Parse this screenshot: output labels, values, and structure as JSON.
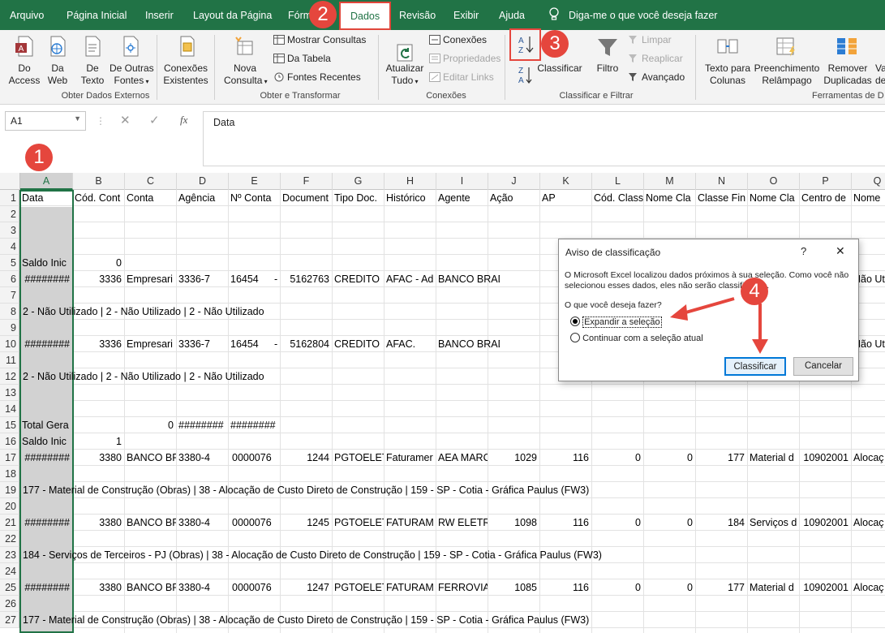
{
  "menu": {
    "tabs": [
      "Arquivo",
      "Página Inicial",
      "Inserir",
      "Layout da Página",
      "Fórm",
      "Dados",
      "Revisão",
      "Exibir",
      "Ajuda"
    ],
    "tell_me": "Diga-me o que você deseja fazer"
  },
  "ribbon": {
    "access": [
      "Do",
      "Access"
    ],
    "web": [
      "Da",
      "Web"
    ],
    "text": [
      "De",
      "Texto"
    ],
    "other": [
      "De Outras",
      "Fontes"
    ],
    "existing": [
      "Conexões",
      "Existentes"
    ],
    "group_external": "Obter Dados Externos",
    "new_query": [
      "Nova",
      "Consulta"
    ],
    "show_queries": "Mostrar Consultas",
    "from_table": "Da Tabela",
    "recent_sources": "Fontes Recentes",
    "group_transform": "Obter e Transformar",
    "refresh": [
      "Atualizar",
      "Tudo"
    ],
    "connections": "Conexões",
    "properties": "Propriedades",
    "edit_links": "Editar Links",
    "group_connections": "Conexões",
    "sort": "Classificar",
    "filter": "Filtro",
    "clear": "Limpar",
    "reapply": "Reaplicar",
    "advanced": "Avançado",
    "group_sort": "Classificar e Filtrar",
    "text_cols": [
      "Texto para",
      "Colunas"
    ],
    "flash_fill": [
      "Preenchimento",
      "Relâmpago"
    ],
    "remove_dup": [
      "Remover",
      "Duplicadas"
    ],
    "val": [
      "Va",
      "de"
    ],
    "group_tools": "Ferramentas de D"
  },
  "namebox": "A1",
  "formula": "Data",
  "fx": "fx",
  "columns": [
    "A",
    "B",
    "C",
    "D",
    "E",
    "F",
    "G",
    "H",
    "I",
    "J",
    "K",
    "L",
    "M",
    "N",
    "O",
    "P",
    "Q"
  ],
  "rows": [
    "1",
    "2",
    "3",
    "4",
    "5",
    "6",
    "7",
    "8",
    "9",
    "10",
    "11",
    "12",
    "13",
    "14",
    "15",
    "16",
    "17",
    "18",
    "19",
    "20",
    "21",
    "22",
    "23",
    "24",
    "25",
    "26",
    "27"
  ],
  "headers": [
    "Data",
    "Cód. Cont",
    "Conta",
    "Agência",
    "Nº Conta",
    "Document",
    "Tipo Doc.",
    "Histórico",
    "Agente",
    "Ação",
    "AP",
    "Cód. Class",
    "Nome Cla",
    "Classe Fin",
    "Nome Cla",
    "Centro de",
    "Nome"
  ],
  "r5": [
    "Saldo Inic",
    "0"
  ],
  "r6": [
    "########",
    "3336",
    "Empresari",
    "3336-7",
    "16454",
    "-",
    "5162763",
    "CREDITO",
    "AFAC - Ad",
    "BANCO BRADESCO S.",
    "Não Uti"
  ],
  "r8": "2 - Não Utilizado | 2 - Não Utilizado | 2 - Não Utilizado",
  "r10": [
    "########",
    "3336",
    "Empresari",
    "3336-7",
    "16454",
    "-",
    "5162804",
    "CREDITO",
    "AFAC.",
    "BANCO BRADESCO S.",
    "Não Uti"
  ],
  "r12": "2 - Não Utilizado | 2 - Não Utilizado | 2 - Não Utilizado",
  "r15": [
    "Total Gera",
    "0",
    "########",
    "########"
  ],
  "r16": [
    "Saldo Inic",
    "1"
  ],
  "r17": [
    "########",
    "3380",
    "BANCO BF",
    "3380-4",
    "0000076",
    "1244",
    "PGTOELET",
    "Faturamer",
    "AEA MARC",
    "1029",
    "116",
    "0",
    "0",
    "177",
    "Material d",
    "10902001",
    "Alocaç"
  ],
  "r19": "177 - Material de Construção (Obras) | 38 - Alocação de Custo Direto de Construção | 159 - SP - Cotia - Gráfica Paulus (FW3)",
  "r21": [
    "########",
    "3380",
    "BANCO BF",
    "3380-4",
    "0000076",
    "1245",
    "PGTOELET",
    "FATURAM",
    "RW ELETRI",
    "1098",
    "116",
    "0",
    "0",
    "184",
    "Serviços d",
    "10902001",
    "Alocaç"
  ],
  "r23": "184 - Serviços de Terceiros - PJ (Obras) | 38 - Alocação de Custo Direto de Construção | 159 - SP - Cotia - Gráfica Paulus (FW3)",
  "r25": [
    "########",
    "3380",
    "BANCO BF",
    "3380-4",
    "0000076",
    "1247",
    "PGTOELET",
    "FATURAM",
    "FERROVIA",
    "1085",
    "116",
    "0",
    "0",
    "177",
    "Material d",
    "10902001",
    "Alocaç"
  ],
  "r27": "177 - Material de Construção (Obras) | 38 - Alocação de Custo Direto de Construção | 159 - SP - Cotia - Gráfica Paulus (FW3)",
  "dialog": {
    "title": "Aviso de classificação",
    "help": "?",
    "close": "✕",
    "message": "O Microsoft Excel localizou dados próximos à sua seleção. Como você não selecionou esses dados, eles não serão classificados.",
    "question": "O que você deseja fazer?",
    "opt1": "Expandir a seleção",
    "opt2": "Continuar com a seleção atual",
    "ok": "Classificar",
    "cancel": "Cancelar"
  },
  "badges": [
    "1",
    "2",
    "3",
    "4"
  ],
  "colors": {
    "excel_green": "#217346",
    "badge_red": "#e5463d",
    "selection": "#217346"
  }
}
